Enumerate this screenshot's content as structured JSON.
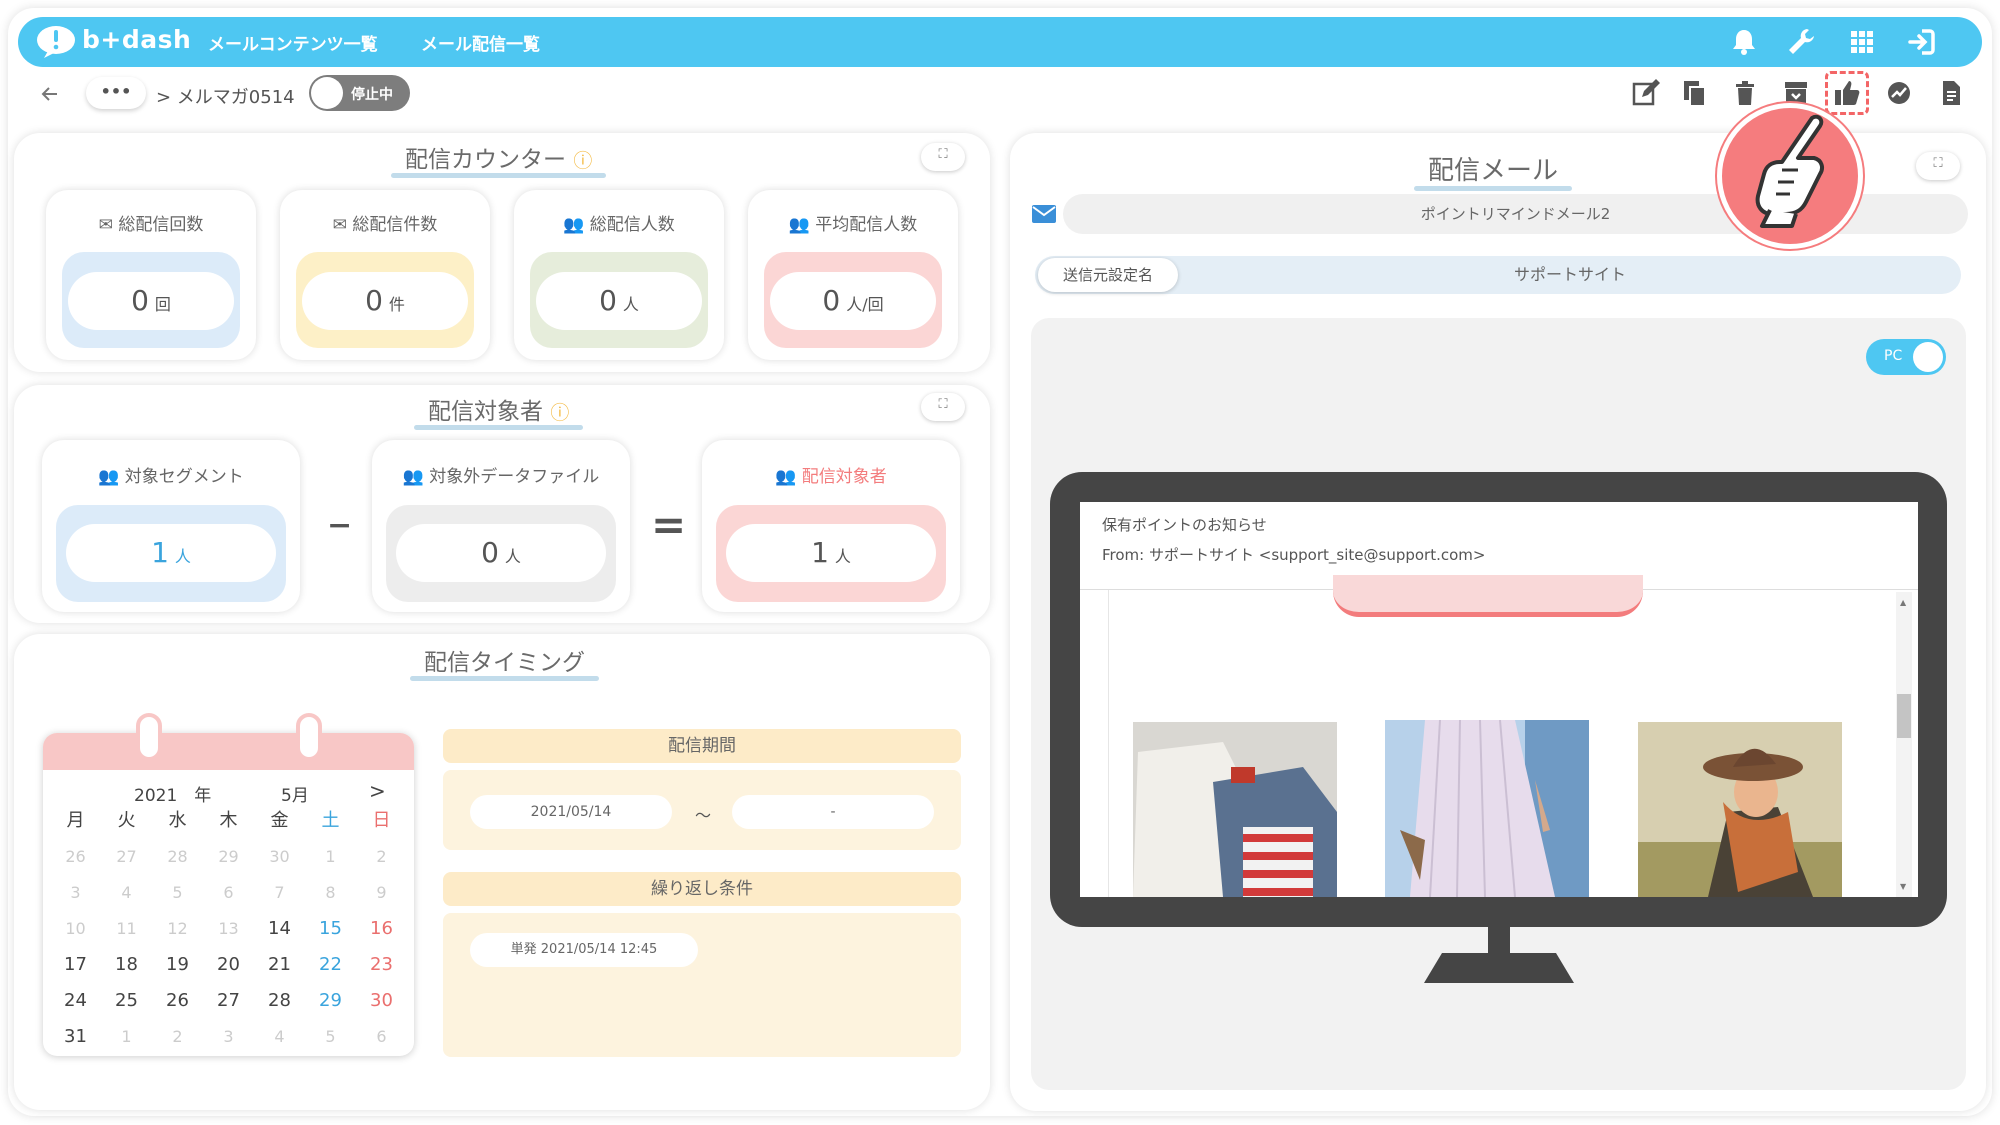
{
  "header": {
    "brand": "b+dash",
    "nav": [
      "メールコンテンツ一覧",
      "メール配信一覧"
    ],
    "icons": [
      "bell-icon",
      "wrench-icon",
      "apps-grid-icon",
      "sign-in-icon"
    ]
  },
  "toolbar": {
    "back_icon": "arrow-left-icon",
    "breadcrumb_more": "•••",
    "breadcrumb_current": "> メルマガ0514",
    "status_toggle": "停止中",
    "actions": [
      "edit-icon",
      "copy-icon",
      "trash-icon",
      "archive-icon",
      "thumbs-up-icon",
      "chart-icon",
      "document-icon"
    ]
  },
  "counter": {
    "title": "配信カウンター",
    "cards": [
      {
        "label": "総配信回数",
        "value": "0",
        "unit": "回",
        "color": "#dcebf9"
      },
      {
        "label": "総配信件数",
        "value": "0",
        "unit": "件",
        "color": "#fdf0c7"
      },
      {
        "label": "総配信人数",
        "value": "0",
        "unit": "人",
        "color": "#e6eddb"
      },
      {
        "label": "平均配信人数",
        "value": "0",
        "unit": "人/回",
        "color": "#fbd6d5"
      }
    ]
  },
  "target": {
    "title": "配信対象者",
    "segment_label": "対象セグメント",
    "segment_value": "1",
    "excluded_label": "対象外データファイル",
    "excluded_value": "0",
    "result_label": "配信対象者",
    "result_value": "1",
    "unit": "人",
    "minus": "−",
    "equals": "="
  },
  "timing": {
    "title": "配信タイミング",
    "calendar": {
      "year": "2021",
      "year_suffix": "年",
      "month": "5月",
      "next": ">",
      "weekdays": [
        "月",
        "火",
        "水",
        "木",
        "金",
        "土",
        "日"
      ],
      "days": [
        [
          "26",
          "27",
          "28",
          "29",
          "30",
          "1",
          "2"
        ],
        [
          "3",
          "4",
          "5",
          "6",
          "7",
          "8",
          "9"
        ],
        [
          "10",
          "11",
          "12",
          "13",
          "14",
          "15",
          "16"
        ],
        [
          "17",
          "18",
          "19",
          "20",
          "21",
          "22",
          "23"
        ],
        [
          "24",
          "25",
          "26",
          "27",
          "28",
          "29",
          "30"
        ],
        [
          "31",
          "1",
          "2",
          "3",
          "4",
          "5",
          "6"
        ]
      ]
    },
    "period_label": "配信期間",
    "period_start": "2021/05/14",
    "period_sep": "～",
    "period_end": "-",
    "repeat_label": "繰り返し条件",
    "repeat_value": "単発 2021/05/14 12:45"
  },
  "mail": {
    "title": "配信メール",
    "mail_name": "ポイントリマインドメール2",
    "sender_label": "送信元設定名",
    "sender_value": "サポートサイト",
    "device_toggle": "PC",
    "preview_subject": "保有ポイントのお知らせ",
    "preview_from": "From: サポートサイト <support_site@support.com>"
  },
  "accent_colors": {
    "header": "#4ec7f2",
    "pink": "#f37c7d",
    "blue": "#3aa4dd"
  }
}
